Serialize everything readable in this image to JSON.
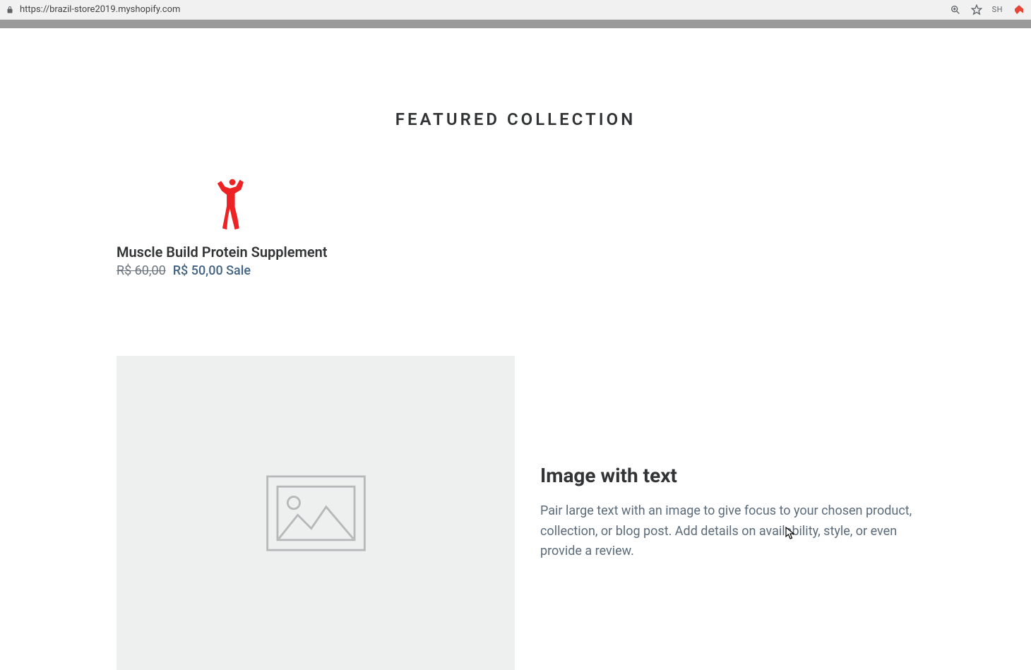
{
  "browser": {
    "url": "https://brazil-store2019.myshopify.com",
    "user": "SH"
  },
  "section": {
    "title": "FEATURED COLLECTION"
  },
  "product": {
    "title": "Muscle Build Protein Supplement",
    "price_old": "R$ 60,00",
    "price_sale": "R$ 50,00 Sale"
  },
  "image_text": {
    "heading": "Image with text",
    "body": "Pair large text with an image to give focus to your chosen product, collection, or blog post. Add details on availability, style, or even provide a review."
  }
}
